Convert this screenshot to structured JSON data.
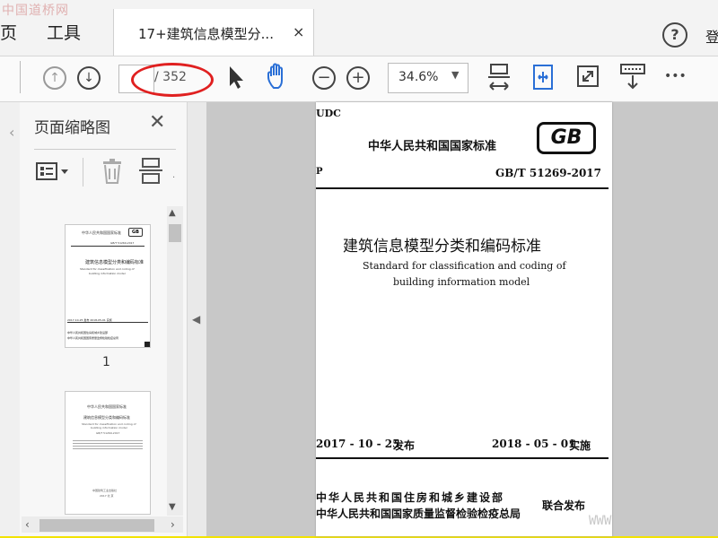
{
  "watermark_top": "中国道桥网",
  "menu": {
    "partial_left": "页",
    "tools": "工具",
    "signin_partial": "登"
  },
  "tab": {
    "label": "17+建筑信息模型分...",
    "close": "×"
  },
  "help": "?",
  "toolbar": {
    "page_count": "/ 352",
    "zoom": "34.6%",
    "more": "•••"
  },
  "sidepane": {
    "title": "页面缩略图",
    "thumbnail_1_number": "1"
  },
  "document": {
    "udc": "UDC",
    "standard_header": "中华人民共和国国家标准",
    "gb_logo": "GB",
    "p_mark": "P",
    "code": "GB/T 51269-2017",
    "title_cn": "建筑信息模型分类和编码标准",
    "title_en_line1": "Standard for classification and coding of",
    "title_en_line2": "building information model",
    "issue_date": "2017 - 10 - 25",
    "issue_label": "发布",
    "effective_date": "2018 - 05 - 01",
    "effective_label": "实施",
    "issuer_1": "中华人民共和国住房和城乡建设部",
    "issuer_2": "中华人民共和国国家质量监督检验检疫总局",
    "joint_release": "联合发布"
  },
  "thumb1": {
    "header": "中华人民共和国国家标准",
    "code": "GB/T 51269-2017",
    "title": "建筑信息模型分类和编码标准",
    "en1": "Standard for classification and coding of",
    "en2": "building information model",
    "dates": "2017-10-25 发布    2018-05-01 实施",
    "issuer1": "中华人民共和国住房和城乡建设部",
    "issuer2": "中华人民共和国国家质量监督检验检疫总局"
  },
  "thumb2": {
    "header": "中华人民共和国国家标准",
    "title": "建筑信息模型分类和编码标准",
    "en": "Standard for classification and coding of",
    "en2": "building information model",
    "code": "GB/T 51269-2017",
    "publisher": "中国建筑工业出版社",
    "year": "2017 北 京"
  },
  "watermark_bottom": "WWW"
}
